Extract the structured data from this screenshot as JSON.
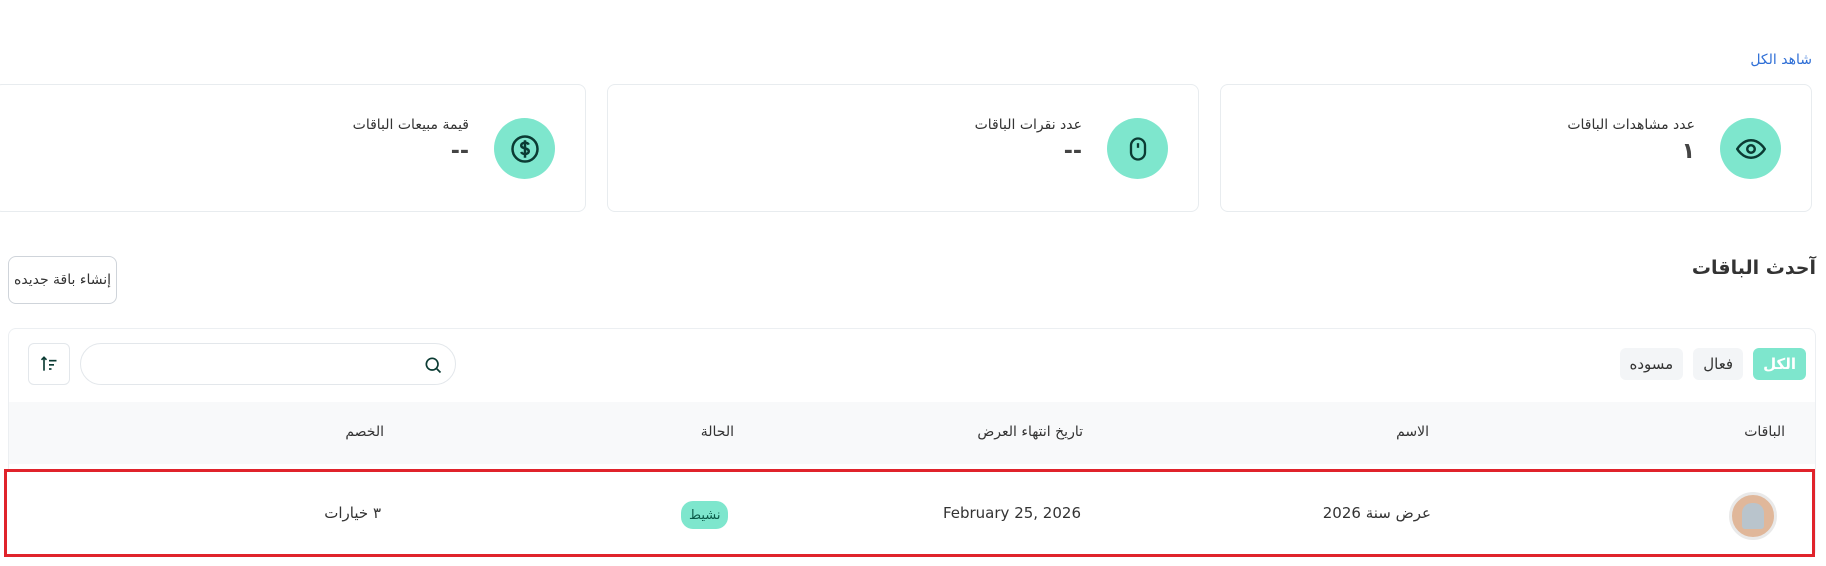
{
  "header": {
    "see_all": "شاهد الكل"
  },
  "stats": [
    {
      "label": "عدد مشاهدات الباقات",
      "value": "١",
      "icon": "eye-icon"
    },
    {
      "label": "عدد نقرات الباقات",
      "value": "--",
      "icon": "mouse-icon"
    },
    {
      "label": "قيمة مبيعات الباقات",
      "value": "--",
      "icon": "dollar-icon"
    }
  ],
  "section": {
    "title": "آحدث الباقات",
    "create_button": "إنشاء باقة جديده"
  },
  "filters": [
    {
      "label": "الكل",
      "active": true
    },
    {
      "label": "فعال",
      "active": false
    },
    {
      "label": "مسوده",
      "active": false
    }
  ],
  "search": {
    "placeholder": ""
  },
  "table": {
    "headers": [
      "الباقات",
      "الاسم",
      "تاريخ انتهاء العرض",
      "الحالة",
      "الخصم"
    ],
    "rows": [
      {
        "name": "عرض سنة 2026",
        "expiry": "February 25, 2026",
        "status": "نشيط",
        "discount": "٣ خيارات"
      }
    ]
  },
  "colors": {
    "accent": "#7ee6cd",
    "link": "#2f6fd6",
    "highlight": "#e0232b"
  }
}
